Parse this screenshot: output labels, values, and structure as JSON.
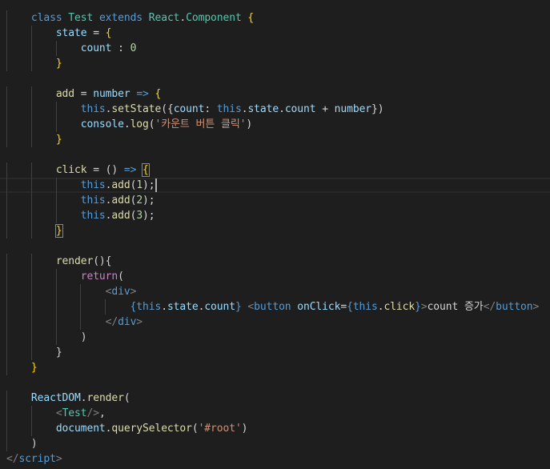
{
  "editor": {
    "language": "javascript",
    "lines": [
      [
        [
          4,
          ""
        ]
      ],
      [
        [
          4,
          ""
        ],
        [
          "k",
          "class "
        ],
        [
          "c",
          "Test "
        ],
        [
          "k",
          "extends "
        ],
        [
          "c",
          "React"
        ],
        [
          "p",
          "."
        ],
        [
          "c",
          "Component "
        ],
        [
          "b",
          "{"
        ]
      ],
      [
        [
          8,
          ""
        ],
        [
          "v",
          "state "
        ],
        [
          "p",
          "= "
        ],
        [
          "b",
          "{"
        ]
      ],
      [
        [
          12,
          ""
        ],
        [
          "v",
          "count "
        ],
        [
          "p",
          ": "
        ],
        [
          "n",
          "0"
        ]
      ],
      [
        [
          8,
          ""
        ],
        [
          "b",
          "}"
        ]
      ],
      [
        [
          0,
          ""
        ]
      ],
      [
        [
          8,
          ""
        ],
        [
          "f",
          "add "
        ],
        [
          "p",
          "= "
        ],
        [
          "v",
          "number "
        ],
        [
          "k",
          "=> "
        ],
        [
          "b",
          "{"
        ]
      ],
      [
        [
          12,
          ""
        ],
        [
          "k",
          "this"
        ],
        [
          "p",
          "."
        ],
        [
          "f",
          "setState"
        ],
        [
          "p",
          "({"
        ],
        [
          "v",
          "count"
        ],
        [
          "p",
          ": "
        ],
        [
          "k",
          "this"
        ],
        [
          "p",
          "."
        ],
        [
          "v",
          "state"
        ],
        [
          "p",
          "."
        ],
        [
          "v",
          "count "
        ],
        [
          "p",
          "+ "
        ],
        [
          "v",
          "number"
        ],
        [
          "p",
          "})"
        ]
      ],
      [
        [
          12,
          ""
        ],
        [
          "v",
          "console"
        ],
        [
          "p",
          "."
        ],
        [
          "f",
          "log"
        ],
        [
          "p",
          "("
        ],
        [
          "s",
          "'카운트 버튼 클릭'"
        ],
        [
          "p",
          ")"
        ]
      ],
      [
        [
          8,
          ""
        ],
        [
          "b",
          "}"
        ]
      ],
      [
        [
          0,
          ""
        ]
      ],
      [
        [
          8,
          ""
        ],
        [
          "f",
          "click "
        ],
        [
          "p",
          "= "
        ],
        [
          "p",
          "() "
        ],
        [
          "k",
          "=> "
        ],
        [
          "bm",
          "{"
        ]
      ],
      [
        [
          12,
          ""
        ],
        [
          "k",
          "this"
        ],
        [
          "p",
          "."
        ],
        [
          "f",
          "add"
        ],
        [
          "p",
          "("
        ],
        [
          "n",
          "1"
        ],
        [
          "p",
          ");"
        ],
        [
          "caret",
          ""
        ]
      ],
      [
        [
          12,
          ""
        ],
        [
          "k",
          "this"
        ],
        [
          "p",
          "."
        ],
        [
          "f",
          "add"
        ],
        [
          "p",
          "("
        ],
        [
          "n",
          "2"
        ],
        [
          "p",
          ");"
        ]
      ],
      [
        [
          12,
          ""
        ],
        [
          "k",
          "this"
        ],
        [
          "p",
          "."
        ],
        [
          "f",
          "add"
        ],
        [
          "p",
          "("
        ],
        [
          "n",
          "3"
        ],
        [
          "p",
          ");"
        ]
      ],
      [
        [
          8,
          ""
        ],
        [
          "bm",
          "}"
        ]
      ],
      [
        [
          0,
          ""
        ]
      ],
      [
        [
          8,
          ""
        ],
        [
          "f",
          "render"
        ],
        [
          "p",
          "(){"
        ]
      ],
      [
        [
          12,
          ""
        ],
        [
          "r",
          "return"
        ],
        [
          "p",
          "("
        ]
      ],
      [
        [
          16,
          ""
        ],
        [
          "t",
          "<"
        ],
        [
          "k",
          "div"
        ],
        [
          "t",
          ">"
        ]
      ],
      [
        [
          20,
          ""
        ],
        [
          "k",
          "{"
        ],
        [
          "k",
          "this"
        ],
        [
          "p",
          "."
        ],
        [
          "v",
          "state"
        ],
        [
          "p",
          "."
        ],
        [
          "v",
          "count"
        ],
        [
          "k",
          "} "
        ],
        [
          "t",
          "<"
        ],
        [
          "k",
          "button "
        ],
        [
          "v",
          "onClick"
        ],
        [
          "p",
          "="
        ],
        [
          "k",
          "{"
        ],
        [
          "k",
          "this"
        ],
        [
          "p",
          "."
        ],
        [
          "f",
          "click"
        ],
        [
          "k",
          "}"
        ],
        [
          "t",
          ">"
        ],
        [
          "p",
          "count 증가"
        ],
        [
          "t",
          "</"
        ],
        [
          "k",
          "button"
        ],
        [
          "t",
          ">"
        ]
      ],
      [
        [
          16,
          ""
        ],
        [
          "t",
          "</"
        ],
        [
          "k",
          "div"
        ],
        [
          "t",
          ">"
        ]
      ],
      [
        [
          12,
          ""
        ],
        [
          "p",
          ")"
        ]
      ],
      [
        [
          8,
          ""
        ],
        [
          "p",
          "}"
        ]
      ],
      [
        [
          4,
          ""
        ],
        [
          "b",
          "}"
        ]
      ],
      [
        [
          0,
          ""
        ]
      ],
      [
        [
          4,
          ""
        ],
        [
          "v",
          "ReactDOM"
        ],
        [
          "p",
          "."
        ],
        [
          "f",
          "render"
        ],
        [
          "p",
          "("
        ]
      ],
      [
        [
          8,
          ""
        ],
        [
          "t",
          "<"
        ],
        [
          "c",
          "Test"
        ],
        [
          "t",
          "/>"
        ],
        [
          "p",
          ","
        ]
      ],
      [
        [
          8,
          ""
        ],
        [
          "v",
          "document"
        ],
        [
          "p",
          "."
        ],
        [
          "f",
          "querySelector"
        ],
        [
          "p",
          "("
        ],
        [
          "s",
          "'#root'"
        ],
        [
          "p",
          ")"
        ]
      ],
      [
        [
          4,
          ""
        ],
        [
          "p",
          ")"
        ]
      ],
      [
        [
          0,
          ""
        ],
        [
          "t",
          "</"
        ],
        [
          "k",
          "script"
        ],
        [
          "t",
          ">"
        ]
      ]
    ]
  }
}
